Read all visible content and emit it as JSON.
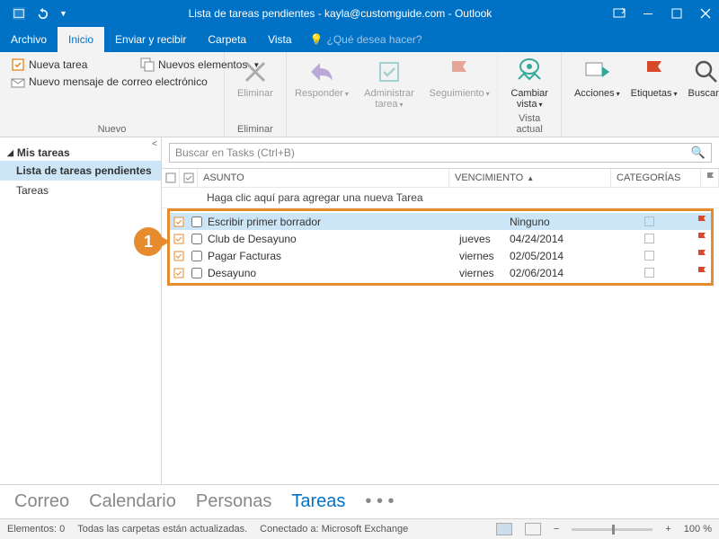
{
  "title": "Lista de tareas pendientes - kayla@customguide.com - Outlook",
  "menu": {
    "archivo": "Archivo",
    "inicio": "Inicio",
    "enviar": "Enviar y recibir",
    "carpeta": "Carpeta",
    "vista": "Vista",
    "help": "¿Qué desea hacer?"
  },
  "ribbon": {
    "nueva_tarea": "Nueva tarea",
    "nuevo_mensaje": "Nuevo mensaje de correo electrónico",
    "nuevos_elementos": "Nuevos elementos",
    "grupo_nuevo": "Nuevo",
    "eliminar": "Eliminar",
    "grupo_eliminar": "Eliminar",
    "responder": "Responder",
    "administrar_tarea": "Administrar tarea",
    "seguimiento": "Seguimiento",
    "cambiar_vista": "Cambiar vista",
    "grupo_vista": "Vista actual",
    "acciones": "Acciones",
    "etiquetas": "Etiquetas",
    "buscar": "Buscar"
  },
  "sidebar": {
    "heading": "Mis tareas",
    "items": [
      {
        "label": "Lista de tareas pendientes",
        "selected": true
      },
      {
        "label": "Tareas",
        "selected": false
      }
    ]
  },
  "search_placeholder": "Buscar en Tasks (Ctrl+B)",
  "columns": {
    "asunto": "ASUNTO",
    "vencimiento": "VENCIMIENTO",
    "categorias": "CATEGORÍAS"
  },
  "addnew": "Haga clic aquí para agregar una nueva Tarea",
  "tasks": [
    {
      "subject": "Escribir primer borrador",
      "day": "",
      "date": "Ninguno",
      "selected": true
    },
    {
      "subject": "Club de Desayuno",
      "day": "jueves",
      "date": "04/24/2014"
    },
    {
      "subject": "Pagar Facturas",
      "day": "viernes",
      "date": "02/05/2014"
    },
    {
      "subject": "Desayuno",
      "day": "viernes",
      "date": "02/06/2014"
    }
  ],
  "callout": "1",
  "modules": {
    "correo": "Correo",
    "calendario": "Calendario",
    "personas": "Personas",
    "tareas": "Tareas"
  },
  "status": {
    "elementos": "Elementos: 0",
    "actualizadas": "Todas las carpetas están actualizadas.",
    "conectado": "Conectado a: Microsoft Exchange",
    "zoom": "100 %"
  }
}
